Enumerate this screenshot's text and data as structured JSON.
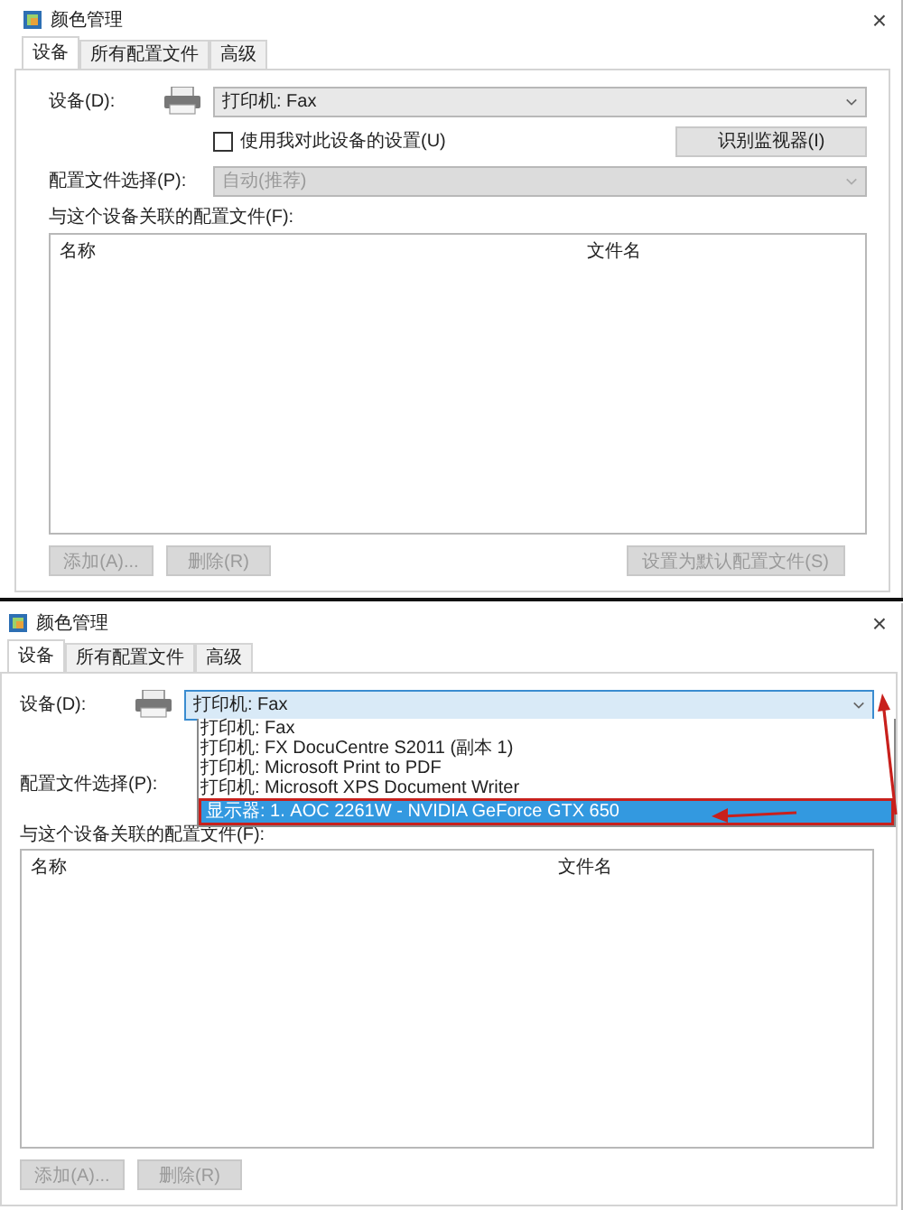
{
  "windows": [
    {
      "title": "颜色管理",
      "close": "×",
      "tabs": [
        {
          "label": "设备",
          "selected": true
        },
        {
          "label": "所有配置文件",
          "selected": false
        },
        {
          "label": "高级",
          "selected": false
        }
      ],
      "device_label": "设备(D):",
      "device_value": "打印机: Fax",
      "device_focused": false,
      "checkbox": {
        "label": "使用我对此设备的设置(U)",
        "checked": false
      },
      "identify_button": "识别监视器(I)",
      "profile_label": "配置文件选择(P):",
      "profile_value": "自动(推荐)",
      "profile_disabled": true,
      "list_label": "与这个设备关联的配置文件(F):",
      "columns": [
        "名称",
        "文件名"
      ],
      "buttons": [
        {
          "label": "添加(A)...",
          "disabled": true,
          "kind": "left"
        },
        {
          "label": "删除(R)",
          "disabled": true,
          "kind": "left"
        },
        {
          "label": "设置为默认配置文件(S)",
          "disabled": true,
          "kind": "right"
        }
      ]
    },
    {
      "title": "颜色管理",
      "close": "×",
      "tabs": [
        {
          "label": "设备",
          "selected": true
        },
        {
          "label": "所有配置文件",
          "selected": false
        },
        {
          "label": "高级",
          "selected": false
        }
      ],
      "device_label": "设备(D):",
      "device_value": "打印机: Fax",
      "device_focused": true,
      "dropdown": {
        "arrows": true,
        "options": [
          {
            "label": "打印机: Fax",
            "selected": false,
            "outlined": false
          },
          {
            "label": "打印机: FX DocuCentre S2011 (副本 1)",
            "selected": false,
            "outlined": false
          },
          {
            "label": "打印机: Microsoft Print to PDF",
            "selected": false,
            "outlined": false
          },
          {
            "label": "打印机: Microsoft XPS Document Writer",
            "selected": false,
            "outlined": false
          },
          {
            "label": "显示器: 1. AOC 2261W - NVIDIA GeForce GTX 650",
            "selected": true,
            "outlined": true
          }
        ]
      },
      "profile_label": "配置文件选择(P):",
      "list_label": "与这个设备关联的配置文件(F):",
      "columns": [
        "名称",
        "文件名"
      ],
      "buttons": [
        {
          "label": "添加(A)...",
          "disabled": true,
          "kind": "left"
        },
        {
          "label": "删除(R)",
          "disabled": true,
          "kind": "left"
        }
      ]
    }
  ]
}
